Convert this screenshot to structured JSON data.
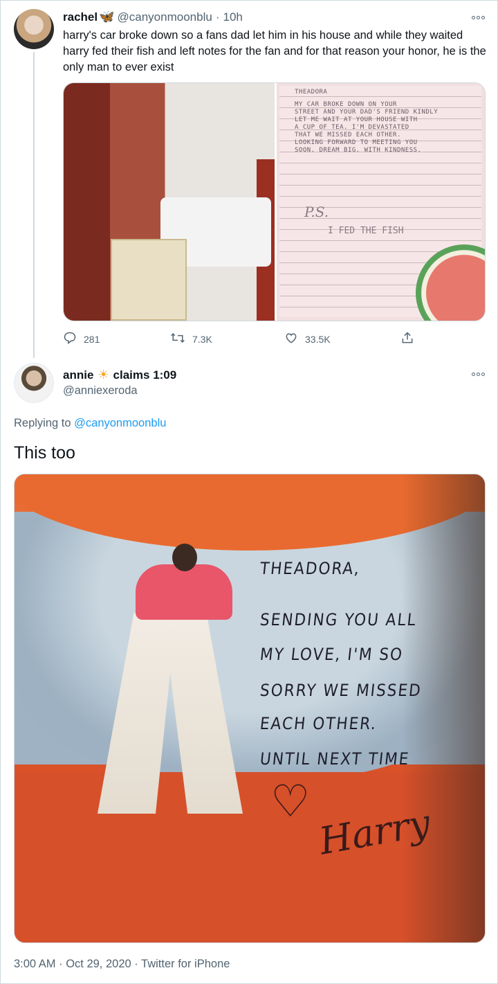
{
  "tweet1": {
    "name": "rachel",
    "handle": "@canyonmoonblu",
    "separator": "·",
    "time": "10h",
    "text": "harry's car broke down so a fans dad let him in his house and while they waited harry fed their fish and left notes for the fan and for that reason your honor, he is the only man to ever exist",
    "note_lines": [
      "THEADORA",
      "MY CAR BROKE DOWN ON YOUR",
      "STREET AND YOUR DAD'S FRIEND KINDLY",
      "LET ME WAIT AT YOUR HOUSE WITH",
      "A CUP OF TEA. I'M DEVASTATED",
      "THAT WE MISSED EACH OTHER.",
      "LOOKING FORWARD TO MEETING YOU",
      "SOON. DREAM BIG. WITH KINDNESS."
    ],
    "note_ps": "P.S.",
    "note_fish": "I FED THE FISH",
    "replies": "281",
    "retweets": "7.3K",
    "likes": "33.5K"
  },
  "tweet2": {
    "name": "annie",
    "name_suffix": "claims 1:09",
    "handle": "@anniexeroda",
    "replying_prefix": "Replying to",
    "replying_handle": "@canyonmoonblu",
    "text": "This too",
    "photo_lines": [
      "THEADORA,",
      "SENDING YOU ALL",
      "MY LOVE, I'M SO",
      "SORRY WE MISSED",
      "EACH OTHER.",
      "UNTIL NEXT TIME"
    ],
    "photo_signature": "Harry",
    "timestamp": "3:00 AM · Oct 29, 2020 · Twitter for iPhone"
  },
  "icons": {
    "verified_like": "butterfly-emoji",
    "sun": "sun-emoji",
    "reply": "reply-icon",
    "retweet": "retweet-icon",
    "like": "heart-icon",
    "share": "share-icon",
    "more": "more-icon"
  },
  "colors": {
    "link": "#1d9bf0",
    "secondary_text": "#536471",
    "primary_text": "#0f1419",
    "border": "#cfd9de"
  }
}
